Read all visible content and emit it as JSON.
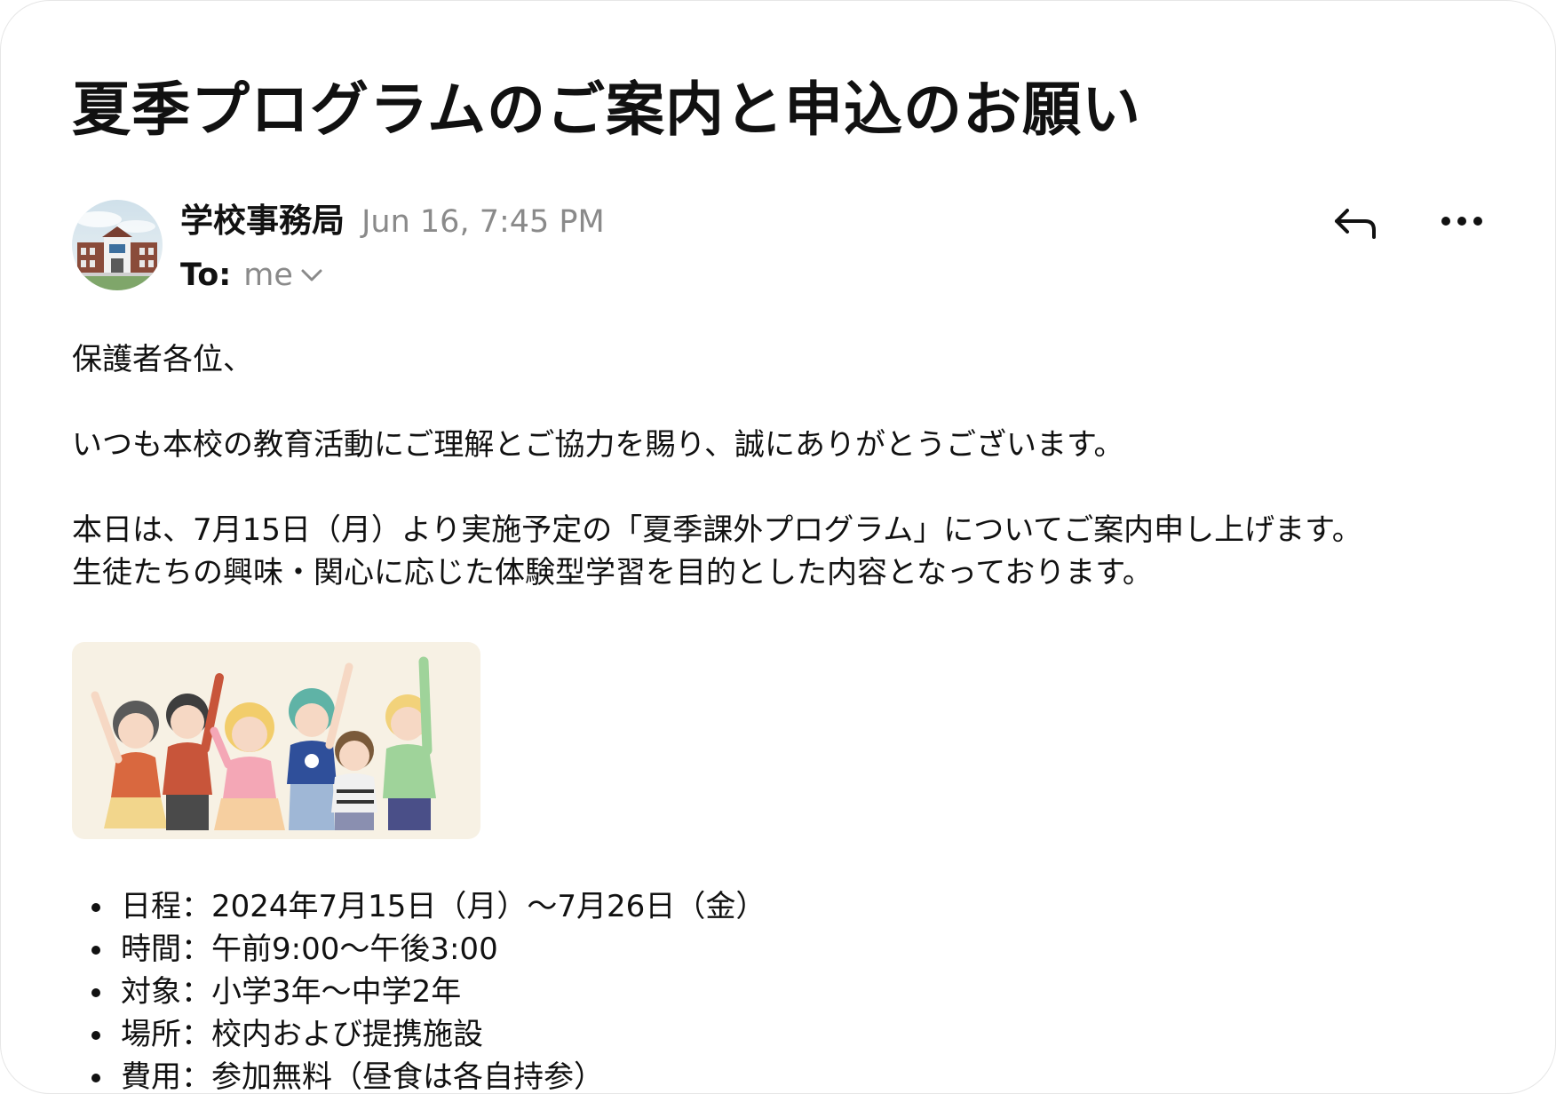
{
  "email": {
    "subject": "夏季プログラムのご案内と申込のお願い",
    "sender_name": "学校事務局",
    "date": "Jun 16, 7:45 PM",
    "to_label": "To:",
    "to_value": "me",
    "avatar_icon": "school-building-photo",
    "actions": {
      "reply_icon": "reply-icon",
      "more_icon": "more-options-icon"
    },
    "body": {
      "greeting": "保護者各位、",
      "para1": "いつも本校の教育活動にご理解とご協力を賜り、誠にありがとうございます。",
      "para2_line1": "本日は、7月15日（月）より実施予定の「夏季課外プログラム」についてご案内申し上げます。",
      "para2_line2": "生徒たちの興味・関心に応じた体験型学習を目的とした内容となっております。",
      "details": [
        "日程：2024年7月15日（月）〜7月26日（金）",
        "時間：午前9:00〜午後3:00",
        "対象：小学3年〜中学2年",
        "場所：校内および提携施設",
        "費用：参加無料（昼食は各自持参）"
      ]
    }
  }
}
